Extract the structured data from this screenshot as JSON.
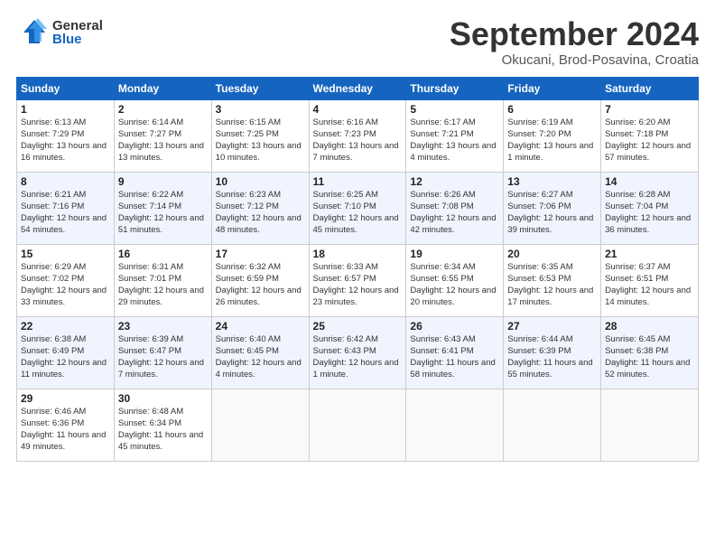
{
  "logo": {
    "general": "General",
    "blue": "Blue"
  },
  "title": {
    "month": "September 2024",
    "location": "Okucani, Brod-Posavina, Croatia"
  },
  "days_of_week": [
    "Sunday",
    "Monday",
    "Tuesday",
    "Wednesday",
    "Thursday",
    "Friday",
    "Saturday"
  ],
  "weeks": [
    [
      {
        "day": "1",
        "sunrise": "Sunrise: 6:13 AM",
        "sunset": "Sunset: 7:29 PM",
        "daylight": "Daylight: 13 hours and 16 minutes."
      },
      {
        "day": "2",
        "sunrise": "Sunrise: 6:14 AM",
        "sunset": "Sunset: 7:27 PM",
        "daylight": "Daylight: 13 hours and 13 minutes."
      },
      {
        "day": "3",
        "sunrise": "Sunrise: 6:15 AM",
        "sunset": "Sunset: 7:25 PM",
        "daylight": "Daylight: 13 hours and 10 minutes."
      },
      {
        "day": "4",
        "sunrise": "Sunrise: 6:16 AM",
        "sunset": "Sunset: 7:23 PM",
        "daylight": "Daylight: 13 hours and 7 minutes."
      },
      {
        "day": "5",
        "sunrise": "Sunrise: 6:17 AM",
        "sunset": "Sunset: 7:21 PM",
        "daylight": "Daylight: 13 hours and 4 minutes."
      },
      {
        "day": "6",
        "sunrise": "Sunrise: 6:19 AM",
        "sunset": "Sunset: 7:20 PM",
        "daylight": "Daylight: 13 hours and 1 minute."
      },
      {
        "day": "7",
        "sunrise": "Sunrise: 6:20 AM",
        "sunset": "Sunset: 7:18 PM",
        "daylight": "Daylight: 12 hours and 57 minutes."
      }
    ],
    [
      {
        "day": "8",
        "sunrise": "Sunrise: 6:21 AM",
        "sunset": "Sunset: 7:16 PM",
        "daylight": "Daylight: 12 hours and 54 minutes."
      },
      {
        "day": "9",
        "sunrise": "Sunrise: 6:22 AM",
        "sunset": "Sunset: 7:14 PM",
        "daylight": "Daylight: 12 hours and 51 minutes."
      },
      {
        "day": "10",
        "sunrise": "Sunrise: 6:23 AM",
        "sunset": "Sunset: 7:12 PM",
        "daylight": "Daylight: 12 hours and 48 minutes."
      },
      {
        "day": "11",
        "sunrise": "Sunrise: 6:25 AM",
        "sunset": "Sunset: 7:10 PM",
        "daylight": "Daylight: 12 hours and 45 minutes."
      },
      {
        "day": "12",
        "sunrise": "Sunrise: 6:26 AM",
        "sunset": "Sunset: 7:08 PM",
        "daylight": "Daylight: 12 hours and 42 minutes."
      },
      {
        "day": "13",
        "sunrise": "Sunrise: 6:27 AM",
        "sunset": "Sunset: 7:06 PM",
        "daylight": "Daylight: 12 hours and 39 minutes."
      },
      {
        "day": "14",
        "sunrise": "Sunrise: 6:28 AM",
        "sunset": "Sunset: 7:04 PM",
        "daylight": "Daylight: 12 hours and 36 minutes."
      }
    ],
    [
      {
        "day": "15",
        "sunrise": "Sunrise: 6:29 AM",
        "sunset": "Sunset: 7:02 PM",
        "daylight": "Daylight: 12 hours and 33 minutes."
      },
      {
        "day": "16",
        "sunrise": "Sunrise: 6:31 AM",
        "sunset": "Sunset: 7:01 PM",
        "daylight": "Daylight: 12 hours and 29 minutes."
      },
      {
        "day": "17",
        "sunrise": "Sunrise: 6:32 AM",
        "sunset": "Sunset: 6:59 PM",
        "daylight": "Daylight: 12 hours and 26 minutes."
      },
      {
        "day": "18",
        "sunrise": "Sunrise: 6:33 AM",
        "sunset": "Sunset: 6:57 PM",
        "daylight": "Daylight: 12 hours and 23 minutes."
      },
      {
        "day": "19",
        "sunrise": "Sunrise: 6:34 AM",
        "sunset": "Sunset: 6:55 PM",
        "daylight": "Daylight: 12 hours and 20 minutes."
      },
      {
        "day": "20",
        "sunrise": "Sunrise: 6:35 AM",
        "sunset": "Sunset: 6:53 PM",
        "daylight": "Daylight: 12 hours and 17 minutes."
      },
      {
        "day": "21",
        "sunrise": "Sunrise: 6:37 AM",
        "sunset": "Sunset: 6:51 PM",
        "daylight": "Daylight: 12 hours and 14 minutes."
      }
    ],
    [
      {
        "day": "22",
        "sunrise": "Sunrise: 6:38 AM",
        "sunset": "Sunset: 6:49 PM",
        "daylight": "Daylight: 12 hours and 11 minutes."
      },
      {
        "day": "23",
        "sunrise": "Sunrise: 6:39 AM",
        "sunset": "Sunset: 6:47 PM",
        "daylight": "Daylight: 12 hours and 7 minutes."
      },
      {
        "day": "24",
        "sunrise": "Sunrise: 6:40 AM",
        "sunset": "Sunset: 6:45 PM",
        "daylight": "Daylight: 12 hours and 4 minutes."
      },
      {
        "day": "25",
        "sunrise": "Sunrise: 6:42 AM",
        "sunset": "Sunset: 6:43 PM",
        "daylight": "Daylight: 12 hours and 1 minute."
      },
      {
        "day": "26",
        "sunrise": "Sunrise: 6:43 AM",
        "sunset": "Sunset: 6:41 PM",
        "daylight": "Daylight: 11 hours and 58 minutes."
      },
      {
        "day": "27",
        "sunrise": "Sunrise: 6:44 AM",
        "sunset": "Sunset: 6:39 PM",
        "daylight": "Daylight: 11 hours and 55 minutes."
      },
      {
        "day": "28",
        "sunrise": "Sunrise: 6:45 AM",
        "sunset": "Sunset: 6:38 PM",
        "daylight": "Daylight: 11 hours and 52 minutes."
      }
    ],
    [
      {
        "day": "29",
        "sunrise": "Sunrise: 6:46 AM",
        "sunset": "Sunset: 6:36 PM",
        "daylight": "Daylight: 11 hours and 49 minutes."
      },
      {
        "day": "30",
        "sunrise": "Sunrise: 6:48 AM",
        "sunset": "Sunset: 6:34 PM",
        "daylight": "Daylight: 11 hours and 45 minutes."
      },
      null,
      null,
      null,
      null,
      null
    ]
  ]
}
